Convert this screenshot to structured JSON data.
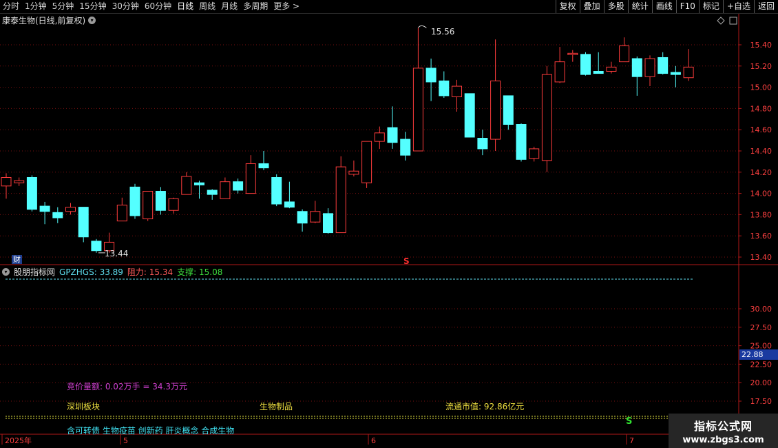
{
  "toolbar": {
    "periods": [
      "分时",
      "1分钟",
      "5分钟",
      "15分钟",
      "30分钟",
      "60分钟",
      "日线",
      "周线",
      "月线",
      "多周期",
      "更多 >"
    ],
    "buttons": [
      "复权",
      "叠加",
      "多股",
      "统计",
      "画线",
      "F10",
      "标记",
      "+自选",
      "返回"
    ]
  },
  "stock": {
    "title": "康泰生物(日线,前复权)"
  },
  "main_chart": {
    "high_label": "15.56",
    "low_label": "13.44",
    "fin_label": "财",
    "signal_label": "S",
    "price_ticks": [
      "15.40",
      "15.20",
      "15.00",
      "14.80",
      "14.60",
      "14.40",
      "14.20",
      "14.00",
      "13.80",
      "13.60",
      "13.40"
    ]
  },
  "indicator": {
    "name": "股朋指标网",
    "gp": "GPZHGS: 33.89",
    "resistance": "阻力: 15.34",
    "support": "支撑: 15.08",
    "ticks": [
      "30.00",
      "27.50",
      "25.00",
      "22.50",
      "20.00",
      "17.50"
    ],
    "current_value": "22.88",
    "signal_label": "S"
  },
  "info": {
    "auction": "竞价量额: 0.02万手 = 34.3万元",
    "board": "深圳板块",
    "industry": "生物制品",
    "market_cap": "流通市值: 92.86亿元",
    "concepts": "含可转债 生物疫苗 创新药 肝炎概念 合成生物"
  },
  "date_axis": [
    "2025年",
    "5",
    "6",
    "7"
  ],
  "watermark": {
    "title": "指标公式网",
    "url": "www.zbgs3.com"
  },
  "colors": {
    "up": "#ff3c3c",
    "down": "#54ffff",
    "grid": "#7a1010",
    "axis": "#b01818"
  },
  "chart_data": {
    "type": "candlestick",
    "price_range": [
      13.35,
      15.65
    ],
    "candles": [
      {
        "o": 14.07,
        "c": 14.15,
        "h": 14.19,
        "l": 13.95
      },
      {
        "o": 14.1,
        "c": 14.12,
        "h": 14.15,
        "l": 14.07
      },
      {
        "o": 14.15,
        "c": 13.85,
        "h": 14.17,
        "l": 13.83
      },
      {
        "o": 13.88,
        "c": 13.83,
        "h": 13.92,
        "l": 13.71
      },
      {
        "o": 13.82,
        "c": 13.77,
        "h": 13.87,
        "l": 13.72
      },
      {
        "o": 13.83,
        "c": 13.87,
        "h": 13.91,
        "l": 13.8
      },
      {
        "o": 13.87,
        "c": 13.59,
        "h": 13.87,
        "l": 13.54
      },
      {
        "o": 13.55,
        "c": 13.46,
        "h": 13.57,
        "l": 13.44
      },
      {
        "o": 13.46,
        "c": 13.54,
        "h": 13.63,
        "l": 13.44
      },
      {
        "o": 13.74,
        "c": 13.89,
        "h": 13.96,
        "l": 13.74
      },
      {
        "o": 14.06,
        "c": 13.79,
        "h": 14.09,
        "l": 13.76
      },
      {
        "o": 13.76,
        "c": 14.02,
        "h": 14.02,
        "l": 13.74
      },
      {
        "o": 14.02,
        "c": 13.84,
        "h": 14.06,
        "l": 13.8
      },
      {
        "o": 13.84,
        "c": 13.95,
        "h": 13.96,
        "l": 13.81
      },
      {
        "o": 13.99,
        "c": 14.16,
        "h": 14.2,
        "l": 13.99
      },
      {
        "o": 14.1,
        "c": 14.08,
        "h": 14.12,
        "l": 13.95
      },
      {
        "o": 14.03,
        "c": 13.99,
        "h": 14.04,
        "l": 13.94
      },
      {
        "o": 13.95,
        "c": 14.11,
        "h": 14.15,
        "l": 13.95
      },
      {
        "o": 14.11,
        "c": 14.03,
        "h": 14.14,
        "l": 14.0
      },
      {
        "o": 14.0,
        "c": 14.28,
        "h": 14.36,
        "l": 14.0
      },
      {
        "o": 14.28,
        "c": 14.24,
        "h": 14.4,
        "l": 14.22
      },
      {
        "o": 14.15,
        "c": 13.9,
        "h": 14.18,
        "l": 13.88
      },
      {
        "o": 13.92,
        "c": 13.87,
        "h": 14.11,
        "l": 13.86
      },
      {
        "o": 13.83,
        "c": 13.72,
        "h": 13.85,
        "l": 13.64
      },
      {
        "o": 13.73,
        "c": 13.83,
        "h": 13.93,
        "l": 13.72
      },
      {
        "o": 13.81,
        "c": 13.63,
        "h": 13.86,
        "l": 13.62
      },
      {
        "o": 13.63,
        "c": 14.25,
        "h": 14.35,
        "l": 13.63
      },
      {
        "o": 14.18,
        "c": 14.21,
        "h": 14.31,
        "l": 14.16
      },
      {
        "o": 14.1,
        "c": 14.49,
        "h": 14.49,
        "l": 14.05
      },
      {
        "o": 14.49,
        "c": 14.57,
        "h": 14.63,
        "l": 14.42
      },
      {
        "o": 14.62,
        "c": 14.48,
        "h": 14.82,
        "l": 14.42
      },
      {
        "o": 14.51,
        "c": 14.36,
        "h": 14.58,
        "l": 14.31
      },
      {
        "o": 14.4,
        "c": 15.18,
        "h": 15.56,
        "l": 14.4
      },
      {
        "o": 15.18,
        "c": 15.05,
        "h": 15.27,
        "l": 14.87
      },
      {
        "o": 15.06,
        "c": 14.92,
        "h": 15.15,
        "l": 14.9
      },
      {
        "o": 14.91,
        "c": 15.01,
        "h": 15.07,
        "l": 14.77
      },
      {
        "o": 14.94,
        "c": 14.53,
        "h": 14.94,
        "l": 14.53
      },
      {
        "o": 14.52,
        "c": 14.42,
        "h": 14.6,
        "l": 14.36
      },
      {
        "o": 14.51,
        "c": 15.06,
        "h": 15.45,
        "l": 14.4
      },
      {
        "o": 14.92,
        "c": 14.65,
        "h": 14.92,
        "l": 14.6
      },
      {
        "o": 14.65,
        "c": 14.32,
        "h": 14.66,
        "l": 14.3
      },
      {
        "o": 14.33,
        "c": 14.42,
        "h": 14.44,
        "l": 14.3
      },
      {
        "o": 14.31,
        "c": 15.12,
        "h": 15.2,
        "l": 14.2
      },
      {
        "o": 15.05,
        "c": 15.24,
        "h": 15.38,
        "l": 15.04
      },
      {
        "o": 15.31,
        "c": 15.32,
        "h": 15.35,
        "l": 15.24
      },
      {
        "o": 15.31,
        "c": 15.12,
        "h": 15.33,
        "l": 15.11
      },
      {
        "o": 15.15,
        "c": 15.13,
        "h": 15.33,
        "l": 15.13
      },
      {
        "o": 15.15,
        "c": 15.19,
        "h": 15.24,
        "l": 15.13
      },
      {
        "o": 15.24,
        "c": 15.39,
        "h": 15.47,
        "l": 15.24
      },
      {
        "o": 15.27,
        "c": 15.1,
        "h": 15.29,
        "l": 14.92
      },
      {
        "o": 15.1,
        "c": 15.27,
        "h": 15.3,
        "l": 15.01
      },
      {
        "o": 15.28,
        "c": 15.13,
        "h": 15.33,
        "l": 15.12
      },
      {
        "o": 15.14,
        "c": 15.12,
        "h": 15.2,
        "l": 15.0
      },
      {
        "o": 15.09,
        "c": 15.19,
        "h": 15.36,
        "l": 15.06
      }
    ]
  }
}
